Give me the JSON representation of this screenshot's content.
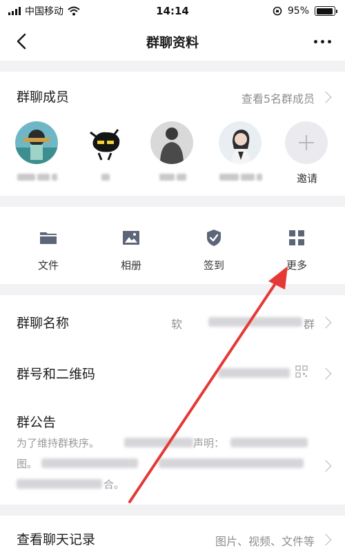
{
  "status_bar": {
    "carrier": "中国移动",
    "time": "14:14",
    "battery": "95%",
    "battery_level": 0.95
  },
  "nav": {
    "title": "群聊资料"
  },
  "members": {
    "title": "群聊成员",
    "view_all": "查看5名群成员",
    "invite_label": "邀请"
  },
  "tools": [
    {
      "label": "文件",
      "icon": "folder-icon"
    },
    {
      "label": "相册",
      "icon": "image-icon"
    },
    {
      "label": "签到",
      "icon": "shield-check-icon"
    },
    {
      "label": "更多",
      "icon": "grid-icon"
    }
  ],
  "info": {
    "group_name_label": "群聊名称",
    "group_name_value_start": "软",
    "group_name_value_end": "群",
    "group_id_label": "群号和二维码",
    "notice_label": "群公告",
    "notice_line1_start": "为了维持群秩序。",
    "notice_line1_mid": "声明：",
    "notice_line2_start": "图。",
    "notice_line3_end": "合。"
  },
  "history": {
    "label": "查看聊天记录",
    "value": "图片、视频、文件等"
  },
  "colors": {
    "annotation_arrow": "#e53935",
    "secondary_text": "#8e8e93"
  }
}
